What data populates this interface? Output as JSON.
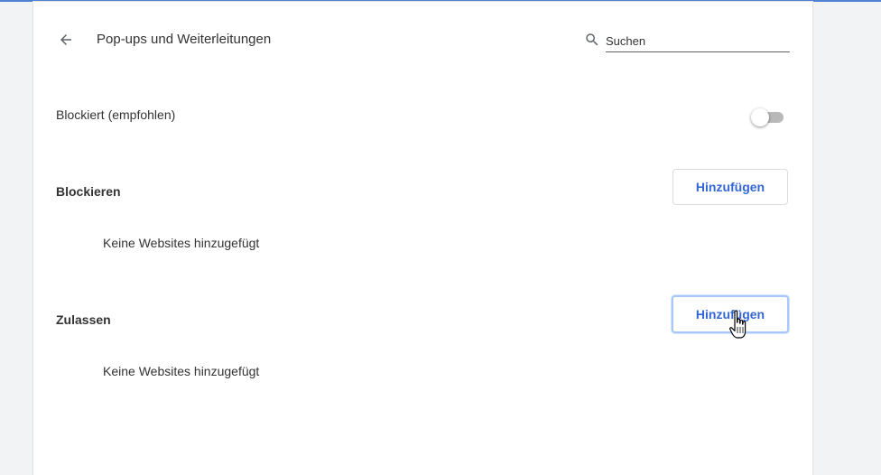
{
  "header": {
    "title": "Pop-ups und Weiterleitungen",
    "back_icon": "arrow-back-icon"
  },
  "search": {
    "placeholder": "Suchen",
    "value": "",
    "icon": "search-icon"
  },
  "blocked_setting": {
    "label": "Blockiert (empfohlen)",
    "enabled": false
  },
  "sections": {
    "block": {
      "title": "Blockieren",
      "add_label": "Hinzufügen",
      "empty_text": "Keine Websites hinzugefügt"
    },
    "allow": {
      "title": "Zulassen",
      "add_label": "Hinzufügen",
      "empty_text": "Keine Websites hinzugefügt"
    }
  },
  "colors": {
    "accent": "#3367d6",
    "top_line": "#4e7fd4",
    "background": "#f1f3f4",
    "card": "#ffffff"
  },
  "cursor": {
    "icon": "hand-pointer-cursor-icon"
  }
}
